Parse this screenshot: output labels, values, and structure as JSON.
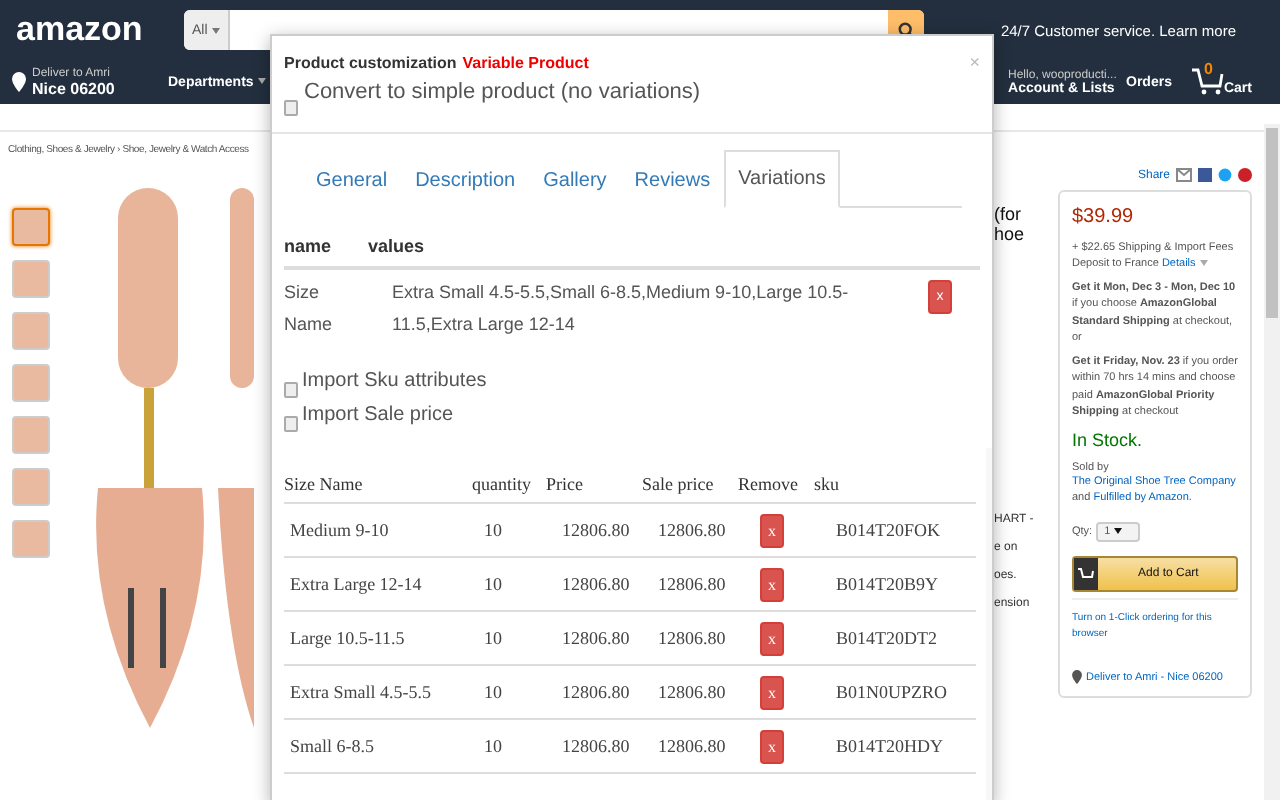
{
  "header": {
    "logo": "amazon",
    "search_category": "All",
    "service_text": "24/7 Customer service. Learn more",
    "deliver_line1": "Deliver to Amri",
    "deliver_line2": "Nice 06200",
    "departments": "Departments",
    "greeting": "Hello, wooproducti...",
    "account": "Account & Lists",
    "orders": "Orders",
    "cart_count": "0",
    "cart": "Cart"
  },
  "breadcrumb": "Clothing, Shoes & Jewelry › Shoe, Jewelry & Watch Access",
  "thumbnails": [
    {
      "selected": true
    },
    {
      "selected": false
    },
    {
      "selected": false
    },
    {
      "selected": false
    },
    {
      "selected": false
    },
    {
      "selected": false
    },
    {
      "selected": false
    }
  ],
  "title_fragments": [
    "(for",
    "hoe"
  ],
  "side_fragments": [
    "HART -",
    "e on",
    "oes.",
    "ension"
  ],
  "share": "Share",
  "buy_box": {
    "price": "$39.99",
    "shipping": "+ $22.65 Shipping & Import Fees Deposit to France",
    "details": "Details",
    "delivery_1": "**Get it Mon, Dec 3 - Mon, Dec 10** if you choose **AmazonGlobal Standard Shipping** at checkout, or",
    "delivery_2": "**Get it Friday, Nov. 23** if you order within 70 hrs 14 mins and choose paid **AmazonGlobal Priority Shipping** at checkout",
    "stock": "In Stock.",
    "sold_by": "Sold by",
    "seller": "The Original Shoe Tree Company",
    "and": "and",
    "fulfilled": "Fulfilled by Amazon.",
    "qty_label": "Qty:",
    "qty": "1",
    "add_to_cart": "Add to Cart",
    "one_click": "Turn on 1-Click ordering for this browser",
    "deliver": "Deliver to Amri - Nice 06200"
  },
  "modal": {
    "title": "Product customization",
    "title_accent": "Variable Product",
    "close": "×",
    "convert": {
      "label": "Convert to simple product (no variations)",
      "checked": false
    },
    "tabs": [
      {
        "label": "General",
        "selected": false
      },
      {
        "label": "Description",
        "selected": false
      },
      {
        "label": "Gallery",
        "selected": false
      },
      {
        "label": "Reviews",
        "selected": false
      },
      {
        "label": "Variations",
        "selected": true
      }
    ],
    "attributes": {
      "columns": [
        "name",
        "values"
      ],
      "rows": [
        {
          "name": "Size Name",
          "values": "Extra Small 4.5-5.5,Small 6-8.5,Medium 9-10,Large 10.5-11.5,Extra Large 12-14",
          "remove": "x"
        }
      ]
    },
    "options": [
      {
        "label": "Import Sku attributes",
        "checked": false
      },
      {
        "label": "Import Sale price",
        "checked": false
      }
    ],
    "variations": {
      "columns": [
        "Size Name",
        "quantity",
        "Price",
        "Sale price",
        "Remove",
        "sku"
      ],
      "rows": [
        {
          "size": "Medium 9-10",
          "quantity": "10",
          "price": "12806.80",
          "sale_price": "12806.80",
          "remove": "x",
          "sku": "B014T20FOK"
        },
        {
          "size": "Extra Large 12-14",
          "quantity": "10",
          "price": "12806.80",
          "sale_price": "12806.80",
          "remove": "x",
          "sku": "B014T20B9Y"
        },
        {
          "size": "Large 10.5-11.5",
          "quantity": "10",
          "price": "12806.80",
          "sale_price": "12806.80",
          "remove": "x",
          "sku": "B014T20DT2"
        },
        {
          "size": "Extra Small 4.5-5.5",
          "quantity": "10",
          "price": "12806.80",
          "sale_price": "12806.80",
          "remove": "x",
          "sku": "B01N0UPZRO"
        },
        {
          "size": "Small 6-8.5",
          "quantity": "10",
          "price": "12806.80",
          "sale_price": "12806.80",
          "remove": "x",
          "sku": "B014T20HDY"
        }
      ]
    }
  }
}
